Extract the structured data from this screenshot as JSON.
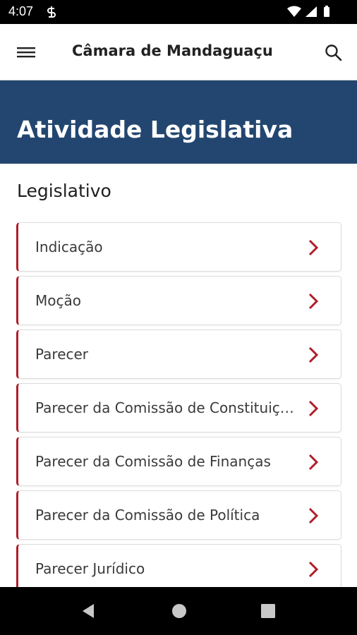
{
  "status_bar": {
    "time": "4:07"
  },
  "app_bar": {
    "title": "Câmara de Mandaguaçu"
  },
  "hero": {
    "title": "Atividade Legislativa"
  },
  "section": {
    "title": "Legislativo"
  },
  "items": [
    {
      "label": "Indicação"
    },
    {
      "label": "Moção"
    },
    {
      "label": "Parecer"
    },
    {
      "label": "Parecer da Comissão de Constituição e Justiça"
    },
    {
      "label": "Parecer da Comissão de Finanças"
    },
    {
      "label": "Parecer da Comissão de Política"
    },
    {
      "label": "Parecer Jurídico"
    }
  ],
  "icons": {
    "menu": "hamburger-menu-icon",
    "search": "search-icon",
    "chevron": "chevron-right-icon",
    "nav_back": "triangle-back-icon",
    "nav_home": "circle-home-icon",
    "nav_recents": "square-recents-icon"
  },
  "colors": {
    "hero_background": "#234670",
    "item_accent": "#b01e2a",
    "chevron": "#b01e2a"
  }
}
